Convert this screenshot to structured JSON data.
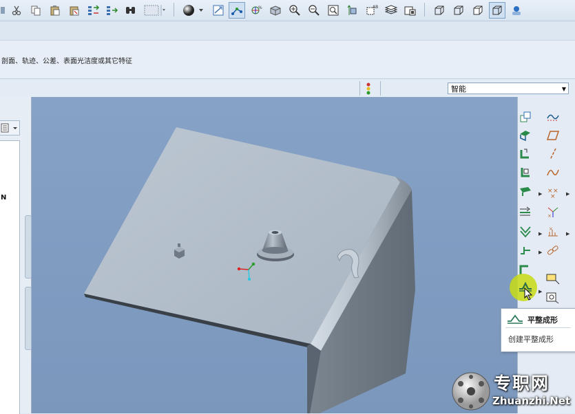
{
  "toolbar": {
    "icons": [
      "scissors-icon",
      "copy-icon",
      "paste-icon",
      "paste-special-icon",
      "regenerate-icon",
      "regenerate-manager-icon",
      "find-icon",
      "select-box-icon",
      "shading-icon",
      "refit-icon",
      "datum-display-icon",
      "spin-center-icon",
      "view-manager-icon",
      "zoom-in-icon",
      "zoom-out-icon",
      "zoom-box-icon",
      "named-view-icon",
      "orient-icon",
      "layers-icon",
      "appearance-icon",
      "wireframe-icon",
      "hidden-line-icon",
      "no-hidden-icon",
      "shaded-icon",
      "model-tree-icon"
    ]
  },
  "prompt": {
    "text": "剖面、轨迹、公差、表面光洁度或其它特征"
  },
  "status": {
    "filter_value": "智能"
  },
  "left_panel": {
    "partial_text": "N"
  },
  "tooltip": {
    "title": "平整成形",
    "description": "创建平整成形"
  },
  "watermark": {
    "cn": "专职网",
    "en": "Zhuanzhi.Net"
  },
  "colors": {
    "viewport_bg": "#7f9bc0",
    "model_face": "#b4c0cc",
    "highlight": "#c8dc14"
  }
}
